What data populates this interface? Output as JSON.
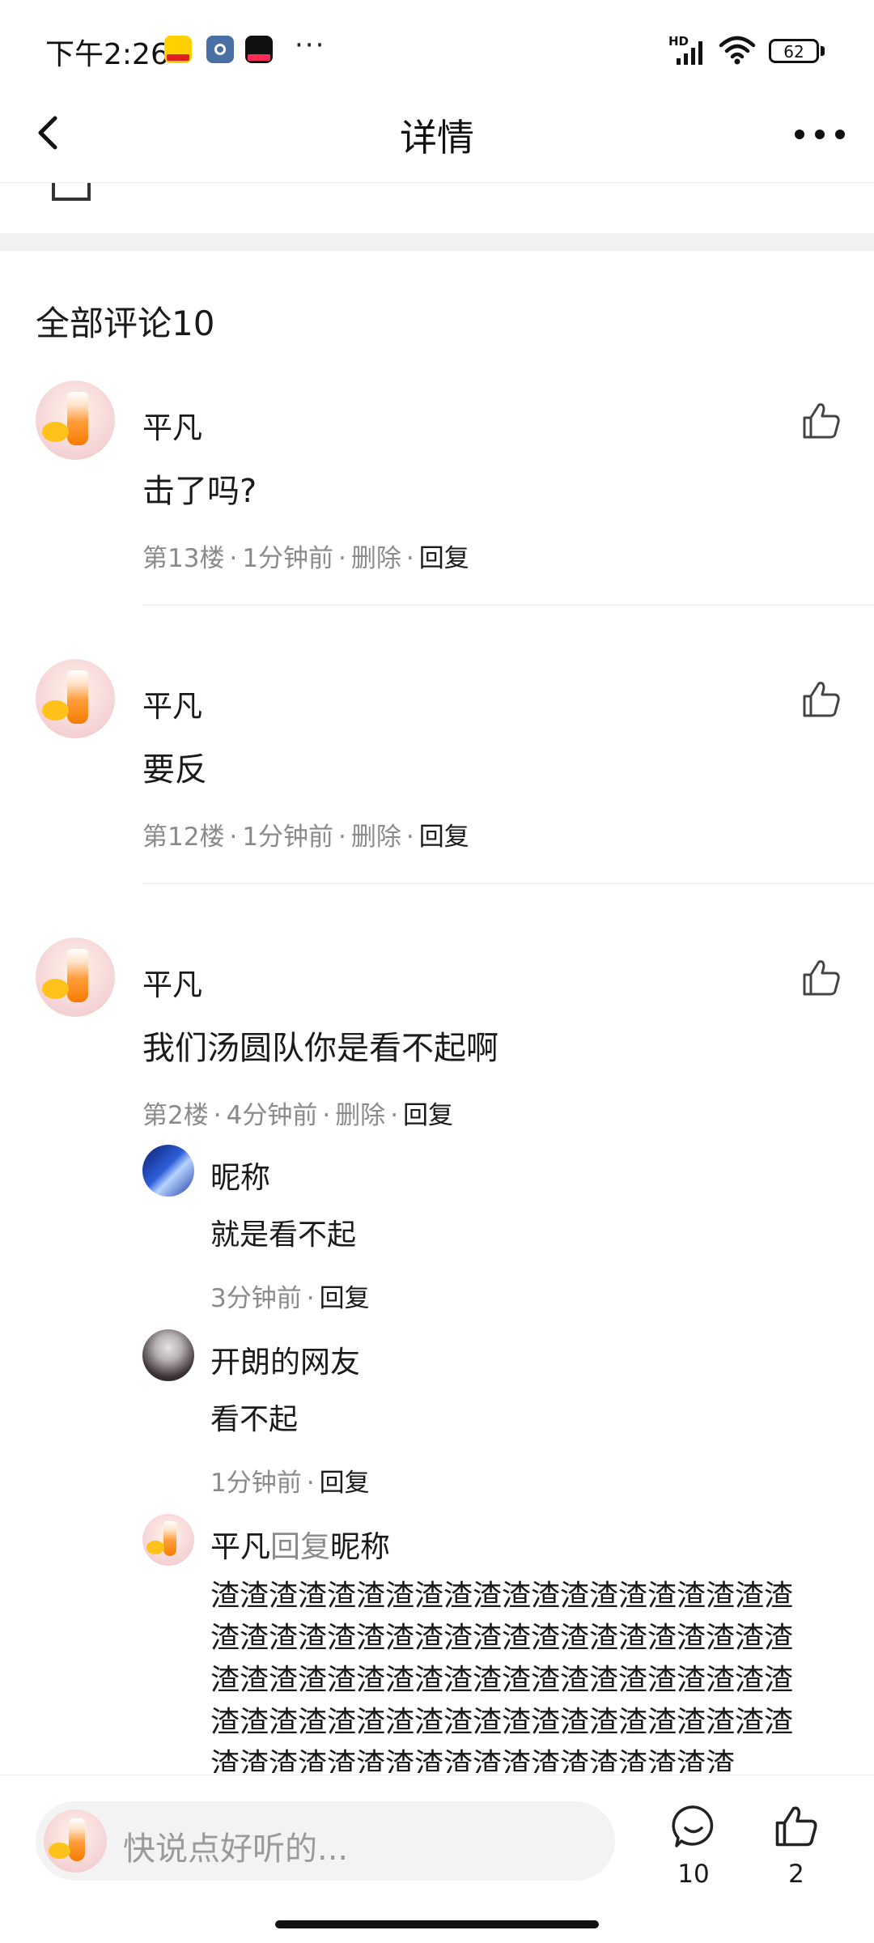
{
  "status_bar": {
    "time": "下午2:26",
    "battery": "62",
    "network": "HD",
    "overflow": "···"
  },
  "header": {
    "title": "详情"
  },
  "comments_header": "全部评论10",
  "comments": [
    {
      "user": "平凡",
      "text": "击了吗?",
      "floor": "第13楼",
      "time": "1分钟前",
      "delete": "删除",
      "reply": "回复"
    },
    {
      "user": "平凡",
      "text": "要反",
      "floor": "第12楼",
      "time": "1分钟前",
      "delete": "删除",
      "reply": "回复"
    },
    {
      "user": "平凡",
      "text": "我们汤圆队你是看不起啊",
      "floor": "第2楼",
      "time": "4分钟前",
      "delete": "删除",
      "reply": "回复",
      "replies": [
        {
          "user": "昵称",
          "text": "就是看不起",
          "time": "3分钟前",
          "reply": "回复"
        },
        {
          "user": "开朗的网友",
          "text": "看不起",
          "time": "1分钟前",
          "reply": "回复"
        },
        {
          "user": "平凡",
          "reply_word": "回复",
          "target": "昵称",
          "text": "渣渣渣渣渣渣渣渣渣渣渣渣渣渣渣渣渣渣渣渣渣渣渣渣渣渣渣渣渣渣渣渣渣渣渣渣渣渣渣渣渣渣渣渣渣渣渣渣渣渣渣渣渣渣渣渣渣渣渣渣渣渣渣渣渣渣渣渣渣渣渣渣渣渣渣渣渣渣渣渣渣渣渣渣渣渣渣渣渣渣渣渣渣渣渣渣渣渣"
        }
      ]
    }
  ],
  "bottom_bar": {
    "placeholder": "快说点好听的...",
    "comment_count": "10",
    "like_count": "2"
  }
}
